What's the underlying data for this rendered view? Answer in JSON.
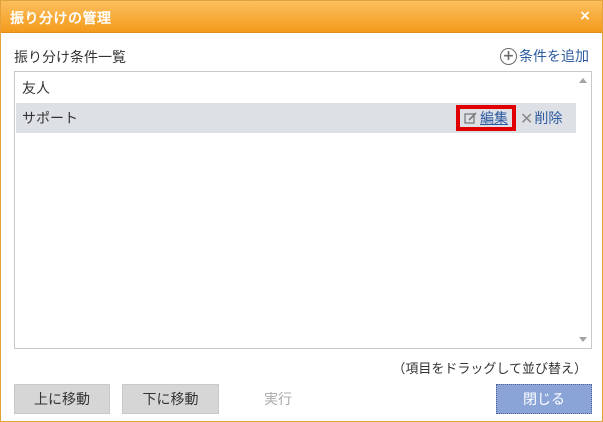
{
  "dialog": {
    "title": "振り分けの管理",
    "close_glyph": "×"
  },
  "list": {
    "label": "振り分け条件一覧",
    "add_label": "条件を追加",
    "items": [
      {
        "name": "友人"
      },
      {
        "name": "サポート",
        "selected": true
      }
    ],
    "edit_label": "編集",
    "delete_label": "削除"
  },
  "hint": "（項目をドラッグして並び替え）",
  "buttons": {
    "move_up": "上に移動",
    "move_down": "下に移動",
    "run": "実行",
    "close": "閉じる"
  },
  "colors": {
    "titlebar": "#f49b1c",
    "link": "#2c5aa0",
    "selected_row": "#dde0e5",
    "highlight_box": "#e00000",
    "primary_button": "#8aa4d8"
  }
}
